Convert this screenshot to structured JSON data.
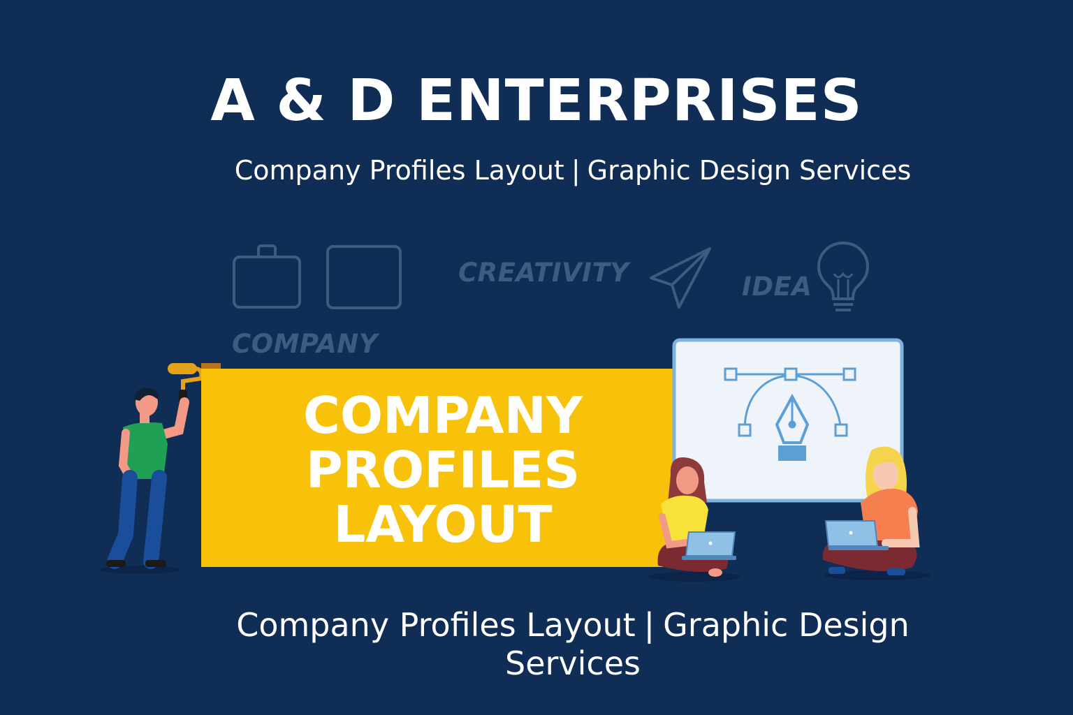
{
  "header": {
    "title": "A & D ENTERPRISES",
    "subtitle_left": "Company Profiles Layout",
    "separator": "|",
    "subtitle_right": "Graphic Design Services"
  },
  "background_words": {
    "creativity": "CREATIVITY",
    "idea": "IDEA",
    "company": "COMPANY"
  },
  "banner": {
    "line1": "COMPANY",
    "line2": "PROFILES",
    "line3": "LAYOUT"
  },
  "footer": {
    "left": "Company Profiles Layout",
    "separator": "|",
    "right": "Graphic Design Services"
  },
  "colors": {
    "background": "#0f2d55",
    "banner": "#f8c20b",
    "faint_icons": "#3e5b82",
    "text": "#ffffff"
  },
  "icons": [
    "briefcase-icon",
    "folder-icon",
    "paper-plane-icon",
    "lightbulb-icon",
    "pen-tool-icon",
    "laptop-icon",
    "paint-roller-icon"
  ]
}
